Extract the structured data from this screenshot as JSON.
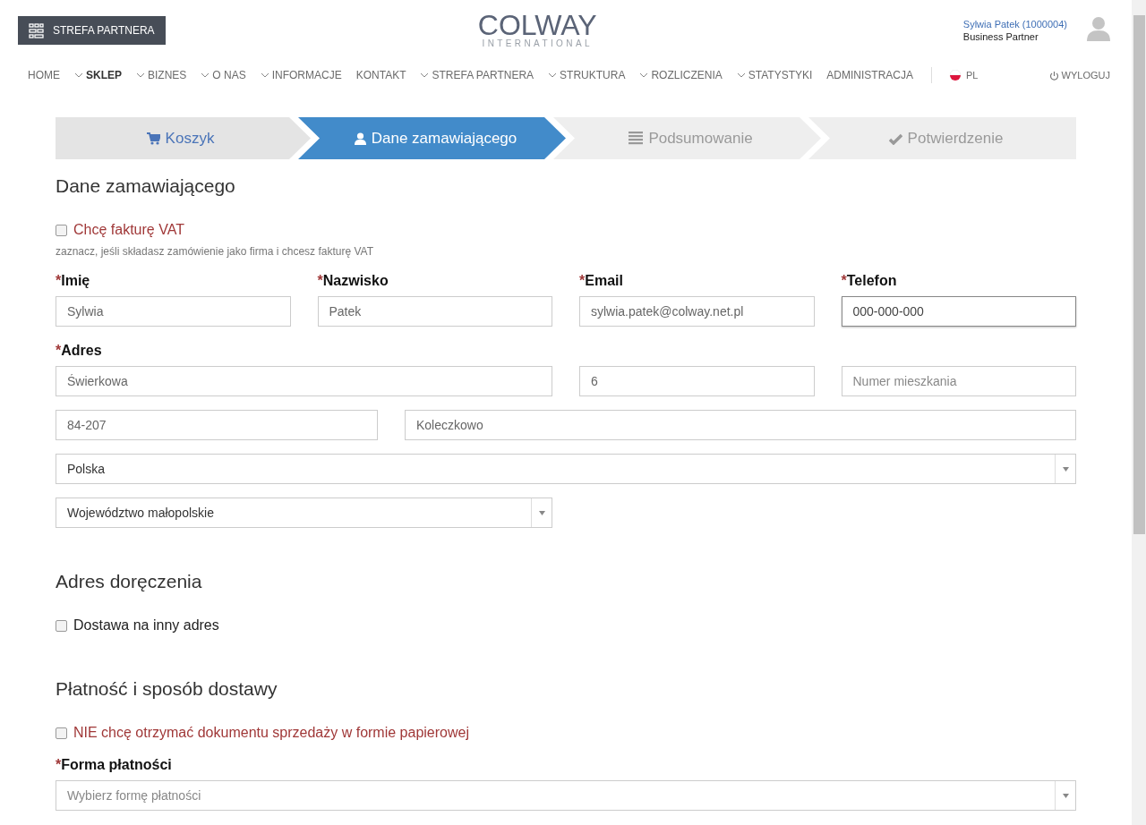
{
  "header": {
    "partner_button": "STREFA PARTNERA",
    "logo": {
      "word": "COLWAY",
      "subtitle": "INTERNATIONAL"
    },
    "user": {
      "name": "Sylwia Patek (1000004)",
      "role": "Business Partner"
    }
  },
  "nav": {
    "items": [
      {
        "label": "HOME",
        "dropdown": false,
        "selected": false
      },
      {
        "label": "SKLEP",
        "dropdown": true,
        "selected": true
      },
      {
        "label": "BIZNES",
        "dropdown": true,
        "selected": false
      },
      {
        "label": "O NAS",
        "dropdown": true,
        "selected": false
      },
      {
        "label": "INFORMACJE",
        "dropdown": true,
        "selected": false
      },
      {
        "label": "KONTAKT",
        "dropdown": false,
        "selected": false
      },
      {
        "label": "STREFA PARTNERA",
        "dropdown": true,
        "selected": false
      },
      {
        "label": "STRUKTURA",
        "dropdown": true,
        "selected": false
      },
      {
        "label": "ROZLICZENIA",
        "dropdown": true,
        "selected": false
      },
      {
        "label": "STATYSTYKI",
        "dropdown": true,
        "selected": false
      },
      {
        "label": "ADMINISTRACJA",
        "dropdown": false,
        "selected": false
      }
    ],
    "language": "PL",
    "logout": "WYLOGUJ"
  },
  "steps": [
    {
      "label": "Koszyk",
      "completed": true,
      "selected": false
    },
    {
      "label": "Dane zamawiającego",
      "completed": false,
      "selected": true
    },
    {
      "label": "Podsumowanie",
      "completed": false,
      "selected": false
    },
    {
      "label": "Potwierdzenie",
      "completed": false,
      "selected": false
    }
  ],
  "orderer": {
    "title": "Dane zamawiającego",
    "vat": {
      "label": "Chcę fakturę VAT",
      "checked": false,
      "kind": "accent"
    },
    "hint": "zaznacz, jeśli składasz zamówienie jako firma i chcesz fakturę VAT",
    "fields": [
      {
        "label": "Imię",
        "required_mark": "*",
        "value": "Sylwia",
        "focused": false
      },
      {
        "label": "Nazwisko",
        "required_mark": "*",
        "value": "Patek",
        "focused": false
      },
      {
        "label": "Email",
        "required_mark": "*",
        "value": "sylwia.patek@colway.net.pl",
        "focused": false
      },
      {
        "label": "Telefon",
        "required_mark": "*",
        "value": "000-000-000",
        "focused": true
      }
    ],
    "address": {
      "label": "Adres",
      "required_mark": "*",
      "rows": [
        [
          {
            "kind": "input",
            "value": "Świerkowa"
          },
          {
            "kind": "input",
            "value": "6"
          },
          {
            "kind": "input",
            "placeholder": "Numer mieszkania"
          }
        ],
        [
          {
            "kind": "input",
            "value": "84-207"
          },
          {
            "kind": "input",
            "value": "Koleczkowo"
          }
        ],
        [
          {
            "kind": "select",
            "value": "Polska"
          }
        ],
        [
          {
            "kind": "select",
            "value": "Województwo małopolskie"
          }
        ]
      ]
    }
  },
  "delivery": {
    "title": "Adres doręczenia",
    "option": {
      "label": "Dostawa na inny adres",
      "checked": false,
      "kind": "plain"
    }
  },
  "payment": {
    "title": "Płatność i sposób dostawy",
    "paper": {
      "label": "NIE chcę otrzymać dokumentu sprzedaży w formie papierowej",
      "checked": false,
      "kind": "accent"
    },
    "method": {
      "label": "Forma płatności",
      "required_mark": "*",
      "placeholder": "Wybierz formę płatności"
    }
  }
}
